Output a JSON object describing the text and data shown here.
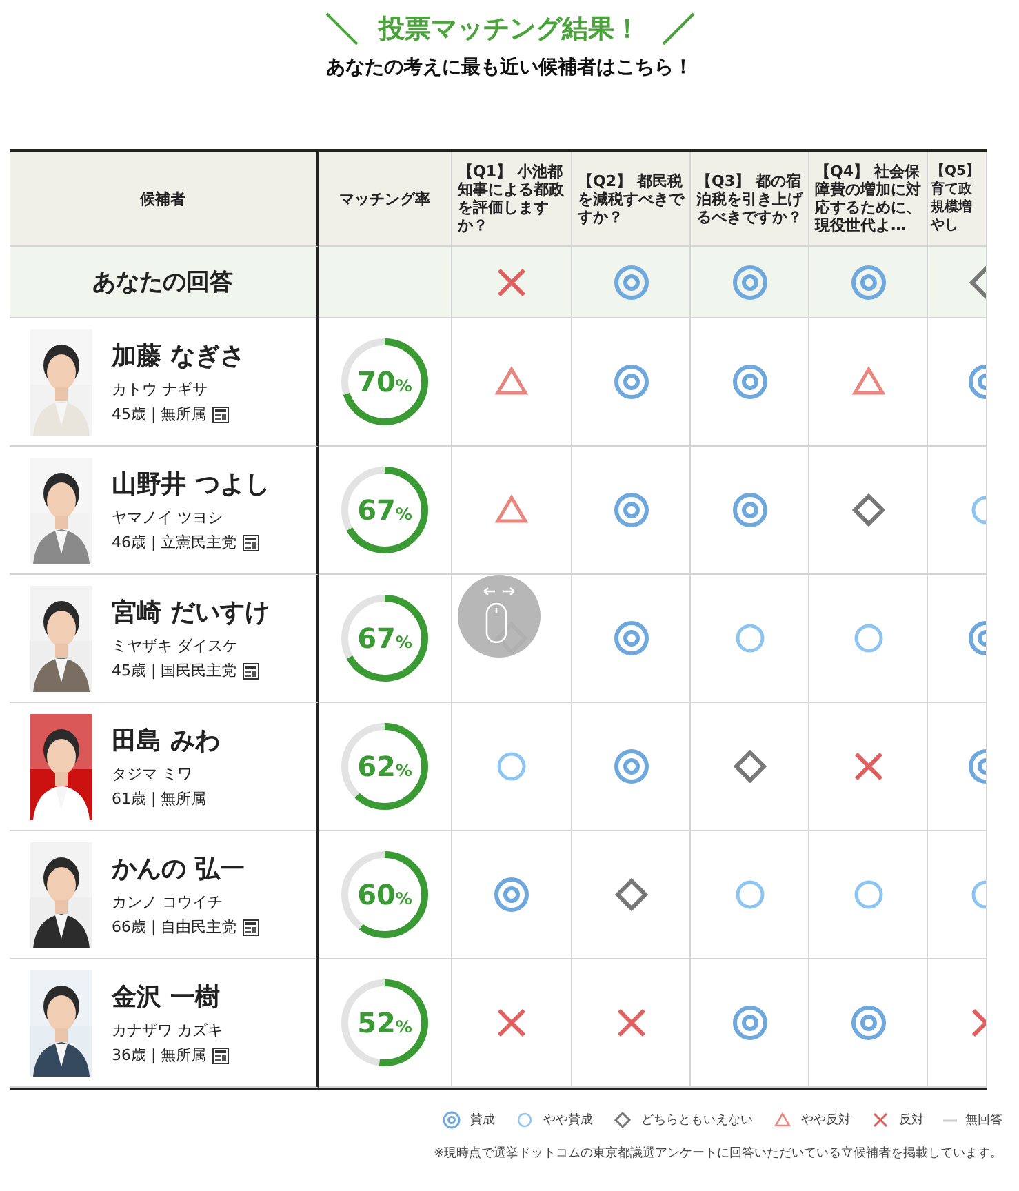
{
  "title": "投票マッチング結果！",
  "subtitle": "あなたの考えに最も近い候補者はこちら！",
  "table": {
    "columns": [
      "候補者",
      "マッチング率",
      "【Q1】 小池都知事による都政を評価しますか？",
      "【Q2】 都民税を減税すべきですか？",
      "【Q3】 都の宿泊税を引き上げるべきですか？",
      "【Q4】 社会保障費の増加に対応するために、現役世代よ…",
      "【Q5】育て政規模増やし"
    ],
    "your_answer": {
      "label": "あなたの回答",
      "answers": [
        {
          "kind": "cross"
        },
        {
          "kind": "strong"
        },
        {
          "kind": "strong"
        },
        {
          "kind": "strong"
        },
        {
          "kind": "neutral"
        }
      ]
    },
    "rows": [
      {
        "name": "加藤 なぎさ",
        "kana": "カトウ ナギサ",
        "info": "45歳 | 無所属",
        "party_icon": true,
        "match": "70%",
        "level": 0.7,
        "answers": [
          {
            "kind": "triangle"
          },
          {
            "kind": "strong"
          },
          {
            "kind": "strong"
          },
          {
            "kind": "triangle"
          },
          {
            "kind": "strong"
          }
        ]
      },
      {
        "name": "山野井 つよし",
        "kana": "ヤマノイ ツヨシ",
        "info": "46歳 | 立憲民主党",
        "party_icon": true,
        "match": "67%",
        "level": 0.67,
        "answers": [
          {
            "kind": "triangle"
          },
          {
            "kind": "strong"
          },
          {
            "kind": "strong"
          },
          {
            "kind": "neutral"
          },
          {
            "kind": "weak"
          }
        ]
      },
      {
        "name": "宮崎 だいすけ",
        "kana": "ミヤザキ ダイスケ",
        "info": "45歳 | 国民民主党",
        "party_icon": true,
        "match": "67%",
        "level": 0.67,
        "answers": [
          {
            "kind": "neutral"
          },
          {
            "kind": "strong"
          },
          {
            "kind": "weak"
          },
          {
            "kind": "weak"
          },
          {
            "kind": "strong"
          }
        ]
      },
      {
        "name": "田島 みわ",
        "kana": "タジマ ミワ",
        "info": "61歳 | 無所属",
        "party_icon": false,
        "match": "62%",
        "level": 0.62,
        "answers": [
          {
            "kind": "weak"
          },
          {
            "kind": "strong"
          },
          {
            "kind": "neutral"
          },
          {
            "kind": "cross"
          },
          {
            "kind": "strong"
          }
        ]
      },
      {
        "name": "かんの 弘一",
        "kana": "カンノ コウイチ",
        "info": "66歳 | 自由民主党",
        "party_icon": true,
        "match": "60%",
        "level": 0.6,
        "answers": [
          {
            "kind": "strong"
          },
          {
            "kind": "neutral"
          },
          {
            "kind": "weak"
          },
          {
            "kind": "weak"
          },
          {
            "kind": "weak"
          }
        ]
      },
      {
        "name": "金沢 一樹",
        "kana": "カナザワ カズキ",
        "info": "36歳 | 無所属",
        "party_icon": true,
        "match": "52%",
        "level": 0.52,
        "answers": [
          {
            "kind": "cross"
          },
          {
            "kind": "cross"
          },
          {
            "kind": "strong"
          },
          {
            "kind": "strong"
          },
          {
            "kind": "cross"
          }
        ]
      }
    ]
  },
  "legend": [
    {
      "kind": "strong",
      "label": "賛成"
    },
    {
      "kind": "weak",
      "label": "やや賛成"
    },
    {
      "kind": "neutral",
      "label": "どちらともいえない"
    },
    {
      "kind": "triangle",
      "label": "やや反対"
    },
    {
      "kind": "cross",
      "label": "反対"
    },
    {
      "kind": "none",
      "label": "無回答"
    }
  ],
  "note": "※現時点で選挙ドットコムの東京都議選アンケートに回答いただいている立候補者を掲載しています。"
}
